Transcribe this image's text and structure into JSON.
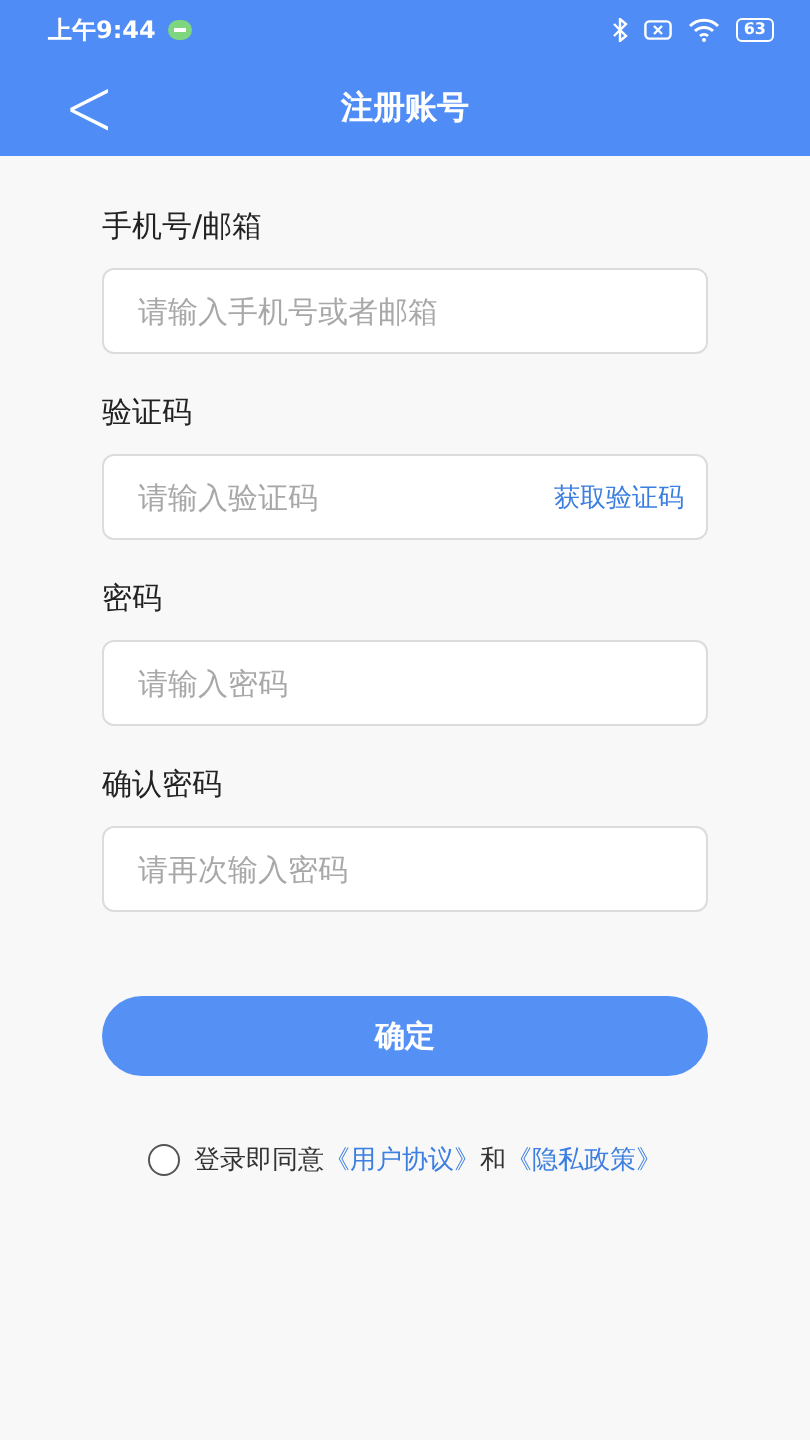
{
  "status_bar": {
    "time": "上午9:44",
    "battery": "63"
  },
  "header": {
    "back": "<",
    "title": "注册账号"
  },
  "fields": [
    {
      "kind": "text",
      "label": "手机号/邮箱",
      "placeholder": "请输入手机号或者邮箱"
    },
    {
      "kind": "code",
      "label": "验证码",
      "placeholder": "请输入验证码",
      "action": "获取验证码"
    },
    {
      "kind": "password",
      "label": "密码",
      "placeholder": "请输入密码"
    },
    {
      "kind": "password",
      "label": "确认密码",
      "placeholder": "请再次输入密码"
    }
  ],
  "submit": "确定",
  "agreement": {
    "checked": false,
    "prefix": "登录即同意",
    "link_1": "《用户协议》",
    "middle": "和",
    "link_2": "《隐私政策》"
  }
}
